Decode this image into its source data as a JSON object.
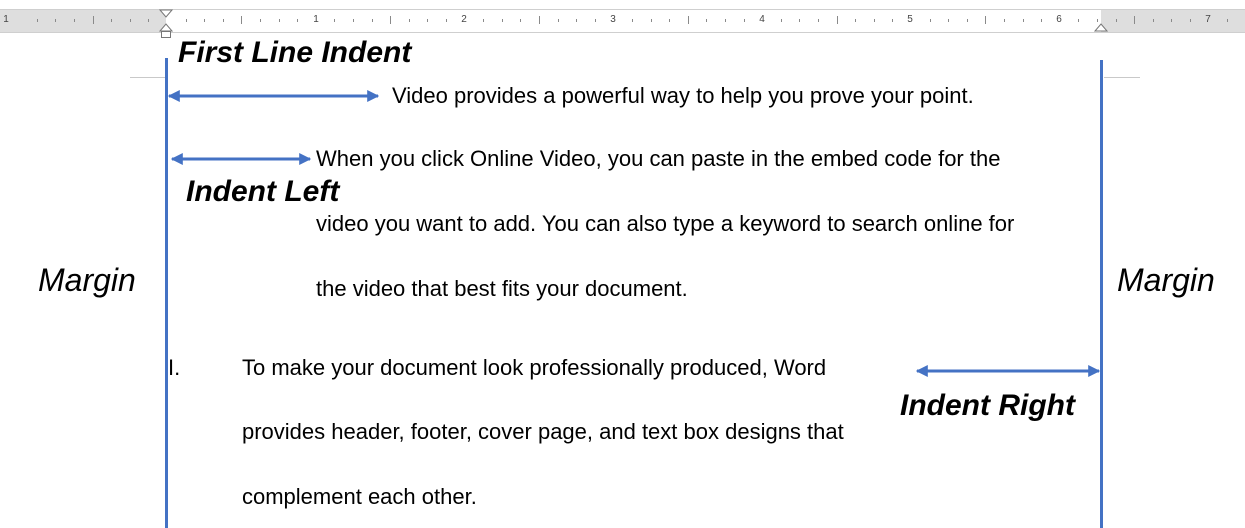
{
  "ruler": {
    "numbers": [
      "1",
      "1",
      "2",
      "3",
      "4",
      "5",
      "6",
      "7"
    ]
  },
  "annotations": {
    "first_line_indent": "First Line Indent",
    "indent_left": "Indent Left",
    "indent_right": "Indent Right",
    "margin_left": "Margin",
    "margin_right": "Margin"
  },
  "paragraphs": {
    "p1": "Video provides a powerful way to help you prove your point.",
    "p2_line1": "When you click Online Video, you can paste in the embed code for the",
    "p2_line2": "video you want to add. You can also type a keyword to search online for",
    "p2_line3": "the video that best fits your document.",
    "list_marker": "I.",
    "p3_line1": "To make your document look professionally produced, Word",
    "p3_line2": "provides header, footer, cover page, and text box designs that",
    "p3_line3": "complement each other."
  },
  "colors": {
    "accent": "#4472c4",
    "ruler_gray": "#dedede"
  }
}
